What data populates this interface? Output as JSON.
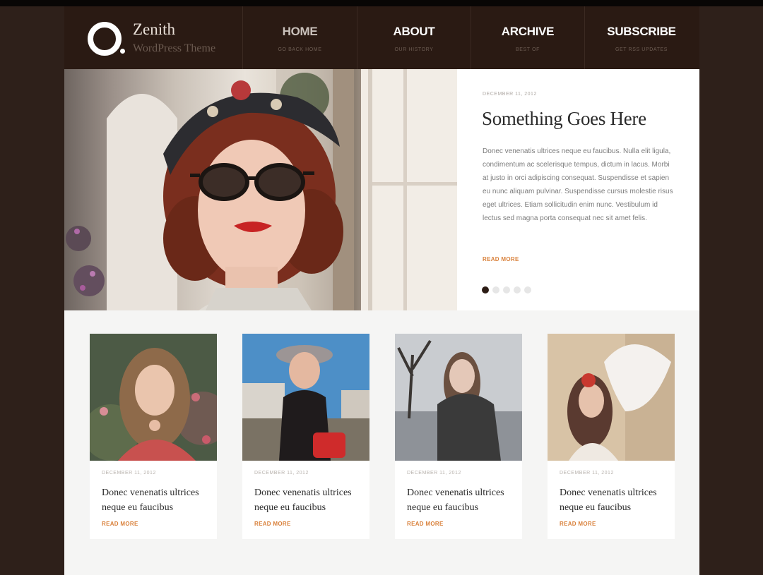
{
  "brand": {
    "name": "Zenith",
    "tagline": "WordPress Theme"
  },
  "nav": [
    {
      "label": "HOME",
      "sub": "GO BACK HOME",
      "active": true
    },
    {
      "label": "ABOUT",
      "sub": "OUR HISTORY"
    },
    {
      "label": "ARCHIVE",
      "sub": "BEST OF"
    },
    {
      "label": "SUBSCRIBE",
      "sub": "GET RSS UPDATES"
    }
  ],
  "hero": {
    "date": "DECEMBER 11, 2012",
    "title": "Something Goes Here",
    "body": "Donec venenatis ultrices neque eu faucibus. Nulla elit ligula, condimentum ac scelerisque tempus, dictum in lacus. Morbi at justo in orci adipiscing consequat. Suspendisse et sapien eu nunc aliquam pulvinar. Suspendisse cursus molestie risus eget ultrices. Etiam sollicitudin enim nunc. Vestibulum id lectus sed magna porta consequat nec sit amet felis.",
    "read_more": "READ MORE",
    "slide_count": 5,
    "active_slide": 1
  },
  "cards": [
    {
      "date": "DECEMBER 11, 2012",
      "title": "Donec venenatis ultrices neque eu faucibus",
      "read_more": "READ MORE"
    },
    {
      "date": "DECEMBER 11, 2012",
      "title": "Donec venenatis ultrices neque eu faucibus",
      "read_more": "READ MORE"
    },
    {
      "date": "DECEMBER 11, 2012",
      "title": "Donec venenatis ultrices neque eu faucibus",
      "read_more": "READ MORE"
    },
    {
      "date": "DECEMBER 11, 2012",
      "title": "Donec venenatis ultrices neque eu faucibus",
      "read_more": "READ MORE"
    }
  ],
  "colors": {
    "header_bg": "#2a1a13",
    "accent": "#d9813b",
    "page_bg": "#2e201a"
  }
}
